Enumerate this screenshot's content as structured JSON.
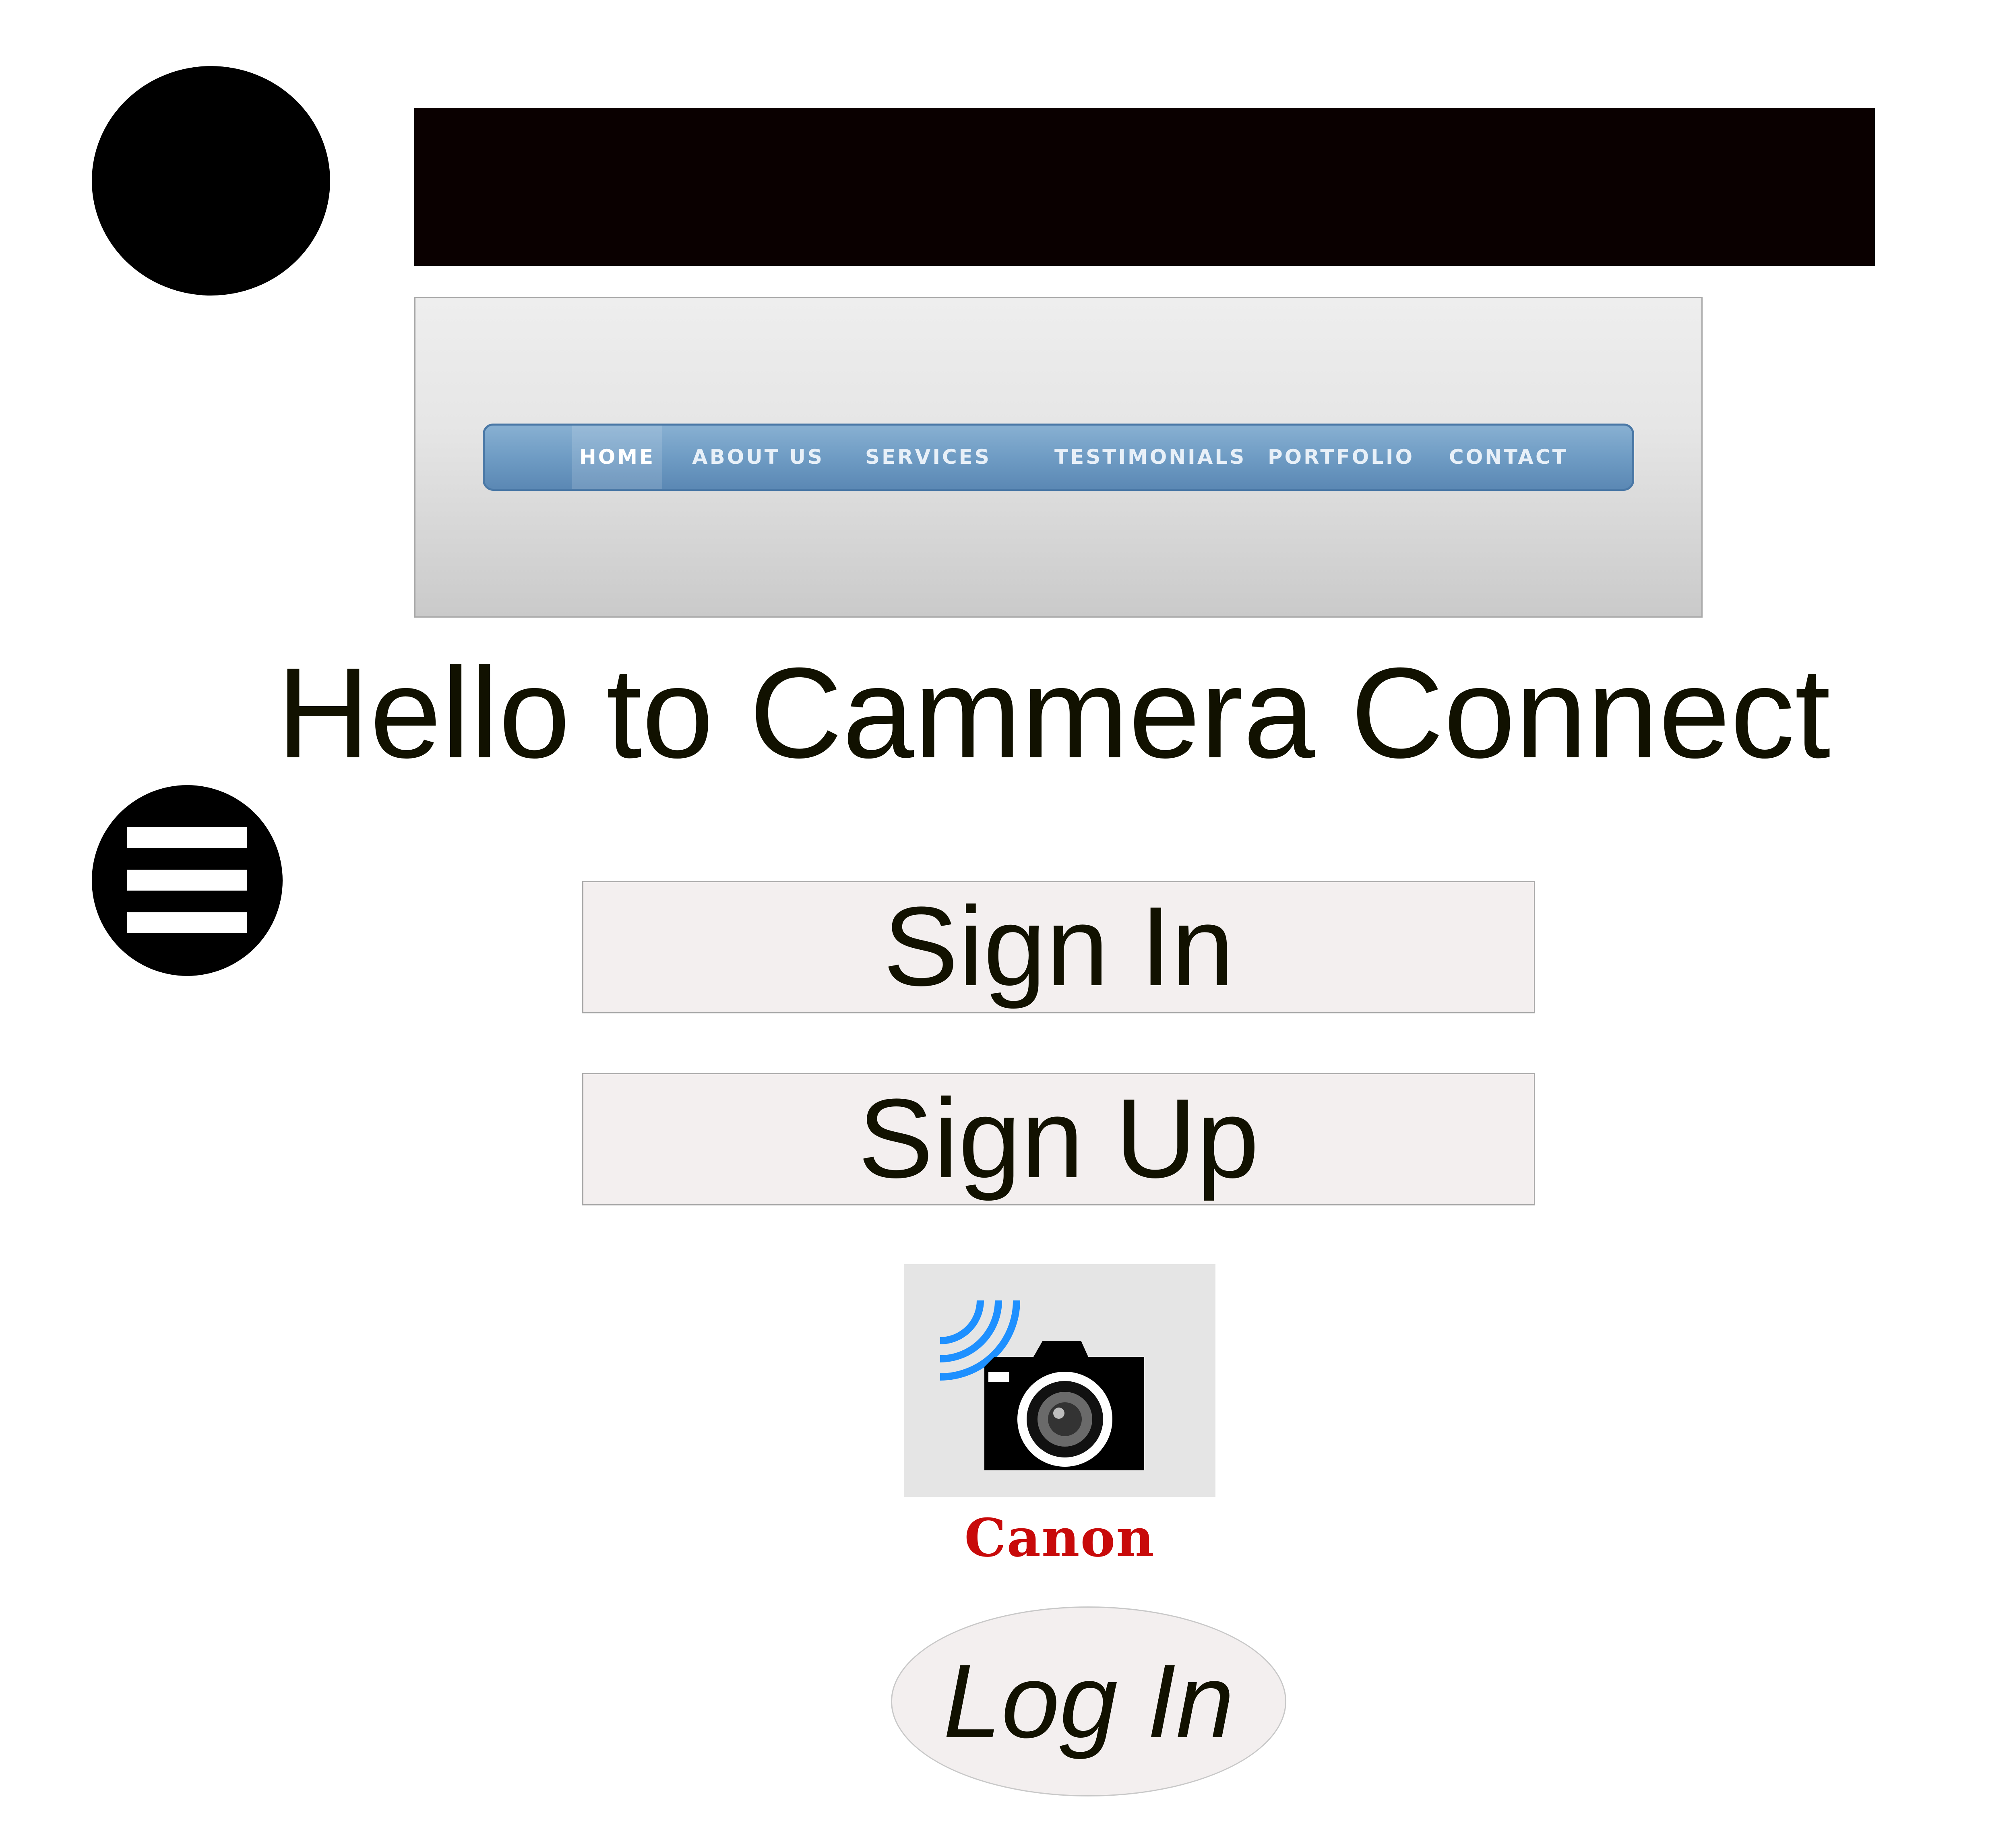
{
  "nav": {
    "items": [
      {
        "label": "HOME"
      },
      {
        "label": "ABOUT US"
      },
      {
        "label": "SERVICES"
      },
      {
        "label": "TESTIMONIALS"
      },
      {
        "label": "PORTFOLIO"
      },
      {
        "label": "CONTACT"
      }
    ]
  },
  "main": {
    "title": "Hello to Cammera Connect",
    "sign_in_label": "Sign In",
    "sign_up_label": "Sign Up",
    "log_in_label": "Log In"
  },
  "logo": {
    "brand": "Canon",
    "icon": "wireless-camera-icon"
  },
  "colors": {
    "nav_bar": "#6f9cc4",
    "button_fill": "#f3efef",
    "brand_red": "#c80a0a",
    "wifi_blue": "#1e90ff"
  }
}
